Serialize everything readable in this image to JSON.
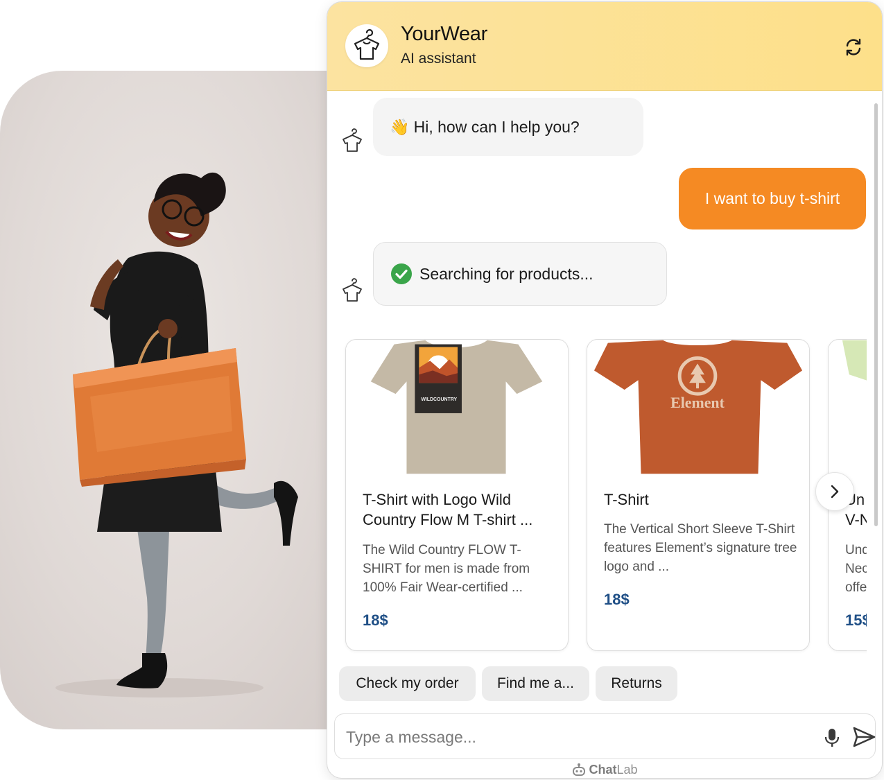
{
  "colors": {
    "header_bg": "#fde08a",
    "user_bubble": "#f58a23",
    "price": "#1f4f86",
    "check_green": "#3aa54a"
  },
  "header": {
    "title": "YourWear",
    "subtitle": "AI assistant",
    "avatar_icon": "tshirt-hanger-icon",
    "refresh_icon": "refresh-icon"
  },
  "messages": {
    "greeting": {
      "emoji": "👋",
      "text": "Hi, how can I help you?"
    },
    "user": {
      "text": "I want to buy t-shirt"
    },
    "status": {
      "icon": "check-circle-icon",
      "text": "Searching for products..."
    }
  },
  "products": [
    {
      "name": "T-Shirt with Logo Wild Country Flow M T-shirt ...",
      "description": "The Wild Country FLOW T-SHIRT for men is made from 100% Fair Wear-certified ...",
      "price": "18$",
      "image_print": "WILDCOUNTRY"
    },
    {
      "name": "T-Shirt",
      "description": "The Vertical Short Sleeve T-Shirt features Element’s signature tree logo and ...",
      "price": "18$",
      "image_print": "Element"
    },
    {
      "name_line1": "Un",
      "name_line2": "V-N",
      "desc_line1": "Und",
      "desc_line2": "Nec",
      "desc_line3": "offe",
      "price": "15$"
    }
  ],
  "carousel": {
    "next_icon": "chevron-right-icon"
  },
  "quick_replies": [
    "Check my order",
    "Find me a...",
    "Returns"
  ],
  "composer": {
    "placeholder": "Type a message...",
    "mic_icon": "microphone-icon",
    "send_icon": "send-icon"
  },
  "footer": {
    "brand_bold": "Chat",
    "brand_light": "Lab"
  }
}
